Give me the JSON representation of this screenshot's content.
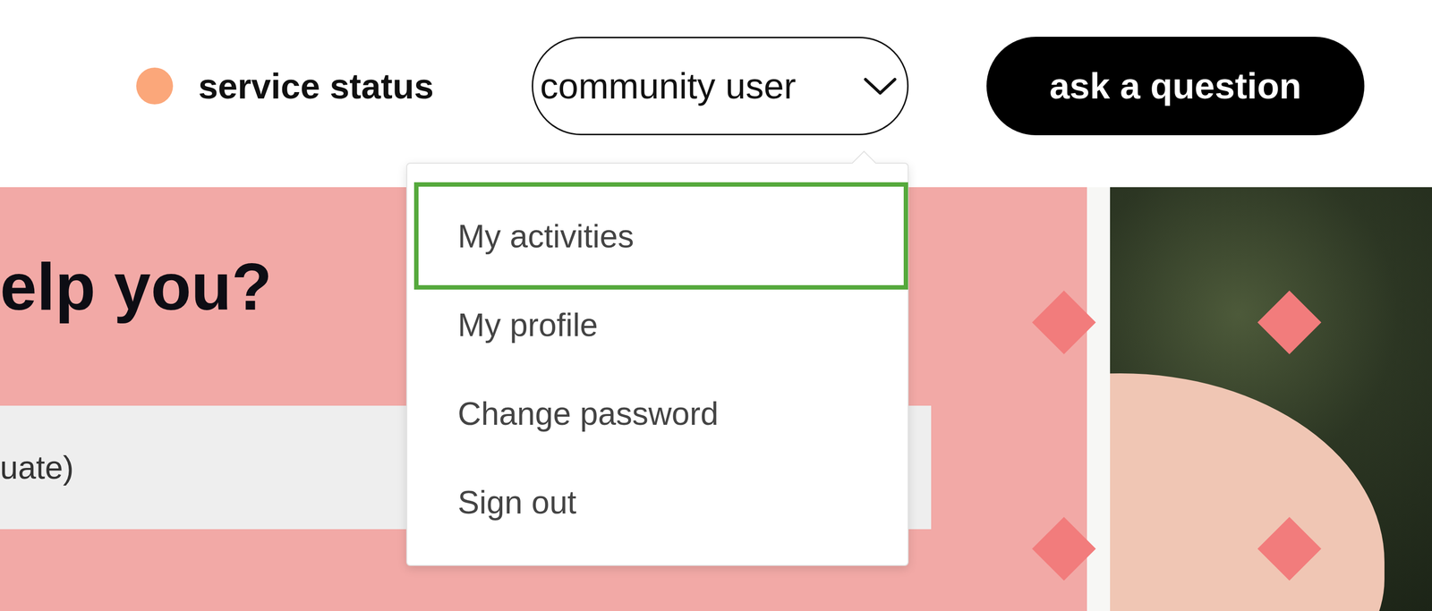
{
  "header": {
    "service_status": {
      "label": "service status",
      "color": "#fba77a"
    },
    "user_menu": {
      "label": "community user",
      "expanded": true
    },
    "ask_button": "ask a question"
  },
  "menu": {
    "items": [
      {
        "label": "My activities",
        "selected": true
      },
      {
        "label": "My profile",
        "selected": false
      },
      {
        "label": "Change password",
        "selected": false
      },
      {
        "label": "Sign out",
        "selected": false
      }
    ]
  },
  "hero": {
    "heading": "elp you?",
    "search": {
      "value": "uate)"
    }
  }
}
